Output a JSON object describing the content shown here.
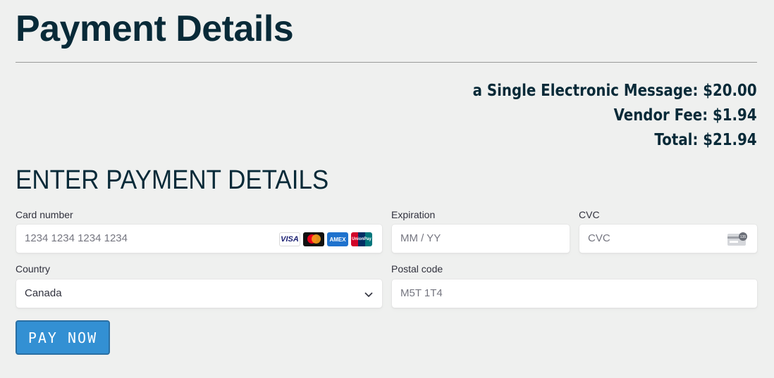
{
  "page": {
    "title": "Payment Details"
  },
  "summary": {
    "item": "a Single Electronic Message: $20.00",
    "vendor_fee": "Vendor Fee: $1.94",
    "total": "Total: $21.94"
  },
  "form": {
    "heading": "ENTER PAYMENT DETAILS",
    "card_number": {
      "label": "Card number",
      "placeholder": "1234 1234 1234 1234",
      "value": ""
    },
    "card_brands": [
      {
        "name": "visa-icon",
        "text": "VISA"
      },
      {
        "name": "mastercard-icon",
        "text": ""
      },
      {
        "name": "amex-icon",
        "text": "AMEX"
      },
      {
        "name": "unionpay-icon",
        "text": "UnionPay"
      }
    ],
    "expiration": {
      "label": "Expiration",
      "placeholder": "MM / YY",
      "value": ""
    },
    "cvc": {
      "label": "CVC",
      "placeholder": "CVC",
      "value": "",
      "icon": "cvc-card-icon",
      "icon_text": "135"
    },
    "country": {
      "label": "Country",
      "value": "Canada",
      "icon": "chevron-down-icon"
    },
    "postal_code": {
      "label": "Postal code",
      "placeholder": "M5T 1T4",
      "value": ""
    },
    "submit_label": "PAY NOW"
  },
  "colors": {
    "background": "#eff0ef",
    "heading": "#082a38",
    "button": "#3390d3",
    "button_border": "#2a6fa3"
  }
}
